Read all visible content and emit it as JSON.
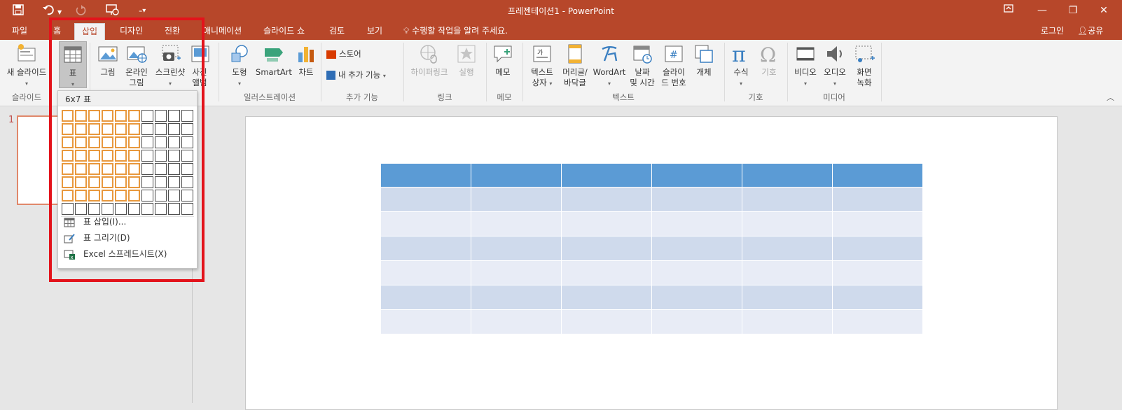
{
  "window": {
    "title": "프레젠테이션1 - PowerPoint",
    "quick_access": {
      "save": "save-icon",
      "undo": "undo-icon",
      "redo": "redo-icon",
      "present": "present-icon",
      "customize": "customize-icon"
    },
    "controls": {
      "ribbon_display": "ribbon-display-icon",
      "restore": "restore-icon",
      "close": "close-icon"
    }
  },
  "tabs": [
    {
      "label": "파일"
    },
    {
      "label": "홈"
    },
    {
      "label": "삽입",
      "active": true
    },
    {
      "label": "디자인"
    },
    {
      "label": "전환"
    },
    {
      "label": "애니메이션"
    },
    {
      "label": "슬라이드 쇼"
    },
    {
      "label": "검토"
    },
    {
      "label": "보기"
    }
  ],
  "tell_me": "수행할 작업을 알려 주세요.",
  "account": {
    "login": "로그인",
    "share": "공유"
  },
  "ribbon": {
    "groups": {
      "slides": "슬라이드",
      "illustrations": "일러스트레이션",
      "addins": "추가 기능",
      "links": "링크",
      "comments": "메모",
      "text": "텍스트",
      "symbols": "기호",
      "media": "미디어"
    },
    "buttons": {
      "new_slide": "새 슬라이드",
      "table": "표",
      "picture": "그림",
      "online_picture_1": "온라인",
      "online_picture_2": "그림",
      "screenshot": "스크린샷",
      "photo_album_1": "사진",
      "photo_album_2": "앨범",
      "shapes": "도형",
      "smartart": "SmartArt",
      "chart": "차트",
      "store": "스토어",
      "my_addins": "내 추가 기능",
      "hyperlink": "하이퍼링크",
      "action": "실행",
      "comment": "메모",
      "textbox_1": "텍스트",
      "textbox_2": "상자",
      "header_1": "머리글/",
      "header_2": "바닥글",
      "wordart": "WordArt",
      "datetime_1": "날짜",
      "datetime_2": "및 시간",
      "slidenum_1": "슬라이",
      "slidenum_2": "드 번호",
      "object": "개체",
      "equation": "수식",
      "symbol": "기호",
      "video": "비디오",
      "audio": "오디오",
      "screen_rec_1": "화면",
      "screen_rec_2": "녹화"
    }
  },
  "table_menu": {
    "header": "6x7 표",
    "selected_cols": 6,
    "selected_rows": 7,
    "grid_cols": 10,
    "grid_rows": 8,
    "items": [
      {
        "label": "표 삽입(I)...",
        "icon": "table-insert-icon"
      },
      {
        "label": "표 그리기(D)",
        "icon": "table-draw-icon"
      },
      {
        "label": "Excel 스프레드시트(X)",
        "icon": "excel-icon"
      }
    ]
  },
  "thumbnail_number": "1",
  "slide_table": {
    "rows": 7,
    "cols": 6
  },
  "colors": {
    "accent": "#b7472a",
    "table_header": "#5b9bd5",
    "table_band_dark": "#cfdaec",
    "table_band_light": "#e8ecf6",
    "highlight_cell": "#e8983d",
    "annotation": "#e3131b"
  }
}
